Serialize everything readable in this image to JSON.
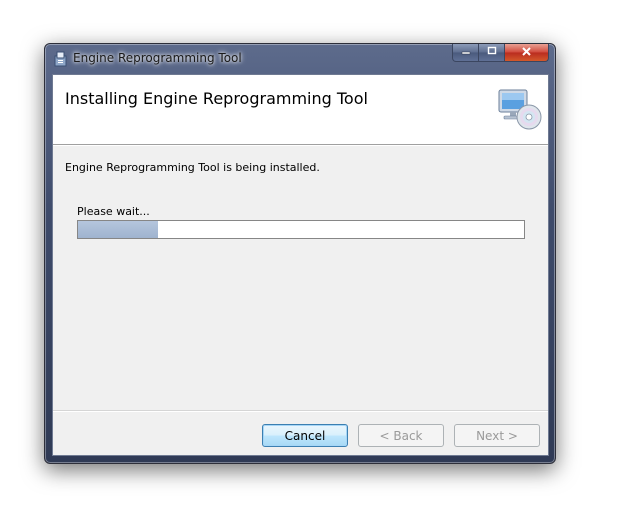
{
  "window": {
    "title": "Engine Reprogramming Tool",
    "caption": {
      "minimize": "—",
      "maximize": "□",
      "close": "✕"
    }
  },
  "banner": {
    "title": "Installing Engine Reprogramming Tool",
    "icon": "computer-cd-icon"
  },
  "body": {
    "status_text": "Engine Reprogramming Tool is being installed.",
    "wait_text": "Please wait...",
    "progress_fraction": 0.18
  },
  "buttons": {
    "cancel_label": "Cancel",
    "back_label": "< Back",
    "next_label": "Next >"
  },
  "colors": {
    "progress_fill": "#9fb3cf",
    "focus_button_border": "#3c7fb1"
  }
}
